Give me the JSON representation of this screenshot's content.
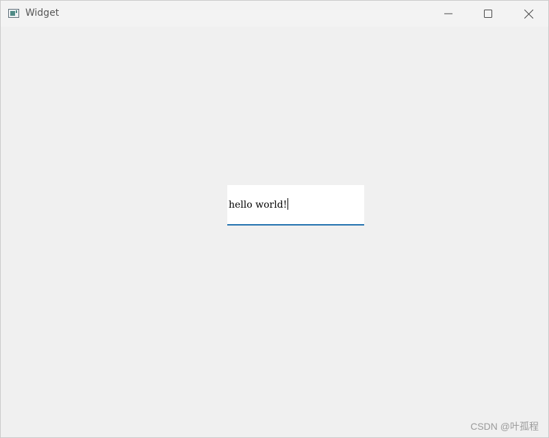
{
  "window": {
    "title": "Widget",
    "controls": {
      "minimize": "minimize-icon",
      "maximize": "maximize-icon",
      "close": "close-icon"
    }
  },
  "line_edit": {
    "value": "hello world!",
    "focused": true,
    "accent_color": "#1f6fad"
  },
  "watermark": "CSDN @叶孤程",
  "colors": {
    "window_bg": "#f0f0f0",
    "titlebar_bg": "#f3f3f3",
    "input_bg": "#ffffff"
  }
}
